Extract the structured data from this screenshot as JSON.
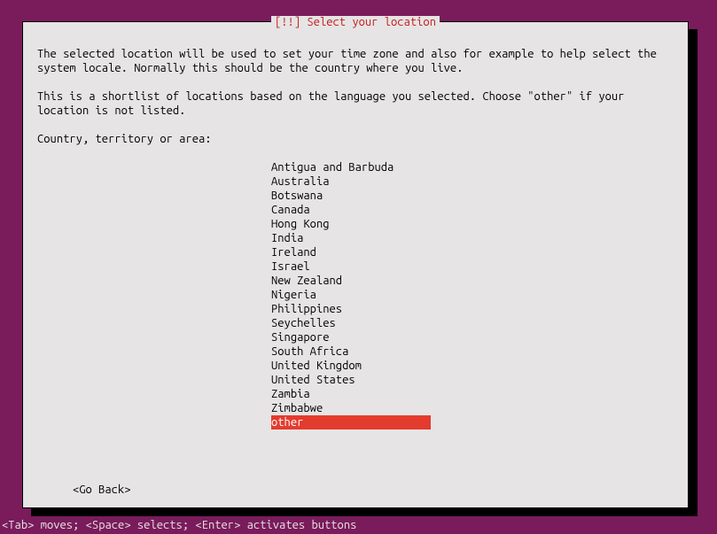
{
  "dialog": {
    "title": "[!!] Select your location",
    "para1": "The selected location will be used to set your time zone and also for example to help select the system locale. Normally this should be the country where you live.",
    "para2": "This is a shortlist of locations based on the language you selected. Choose \"other\" if your location is not listed.",
    "prompt": "Country, territory or area:",
    "items": [
      "Antigua and Barbuda",
      "Australia",
      "Botswana",
      "Canada",
      "Hong Kong",
      "India",
      "Ireland",
      "Israel",
      "New Zealand",
      "Nigeria",
      "Philippines",
      "Seychelles",
      "Singapore",
      "South Africa",
      "United Kingdom",
      "United States",
      "Zambia",
      "Zimbabwe",
      "other"
    ],
    "selected_index": 18,
    "go_back": "<Go Back>"
  },
  "footer": {
    "hint": "<Tab> moves; <Space> selects; <Enter> activates buttons"
  }
}
